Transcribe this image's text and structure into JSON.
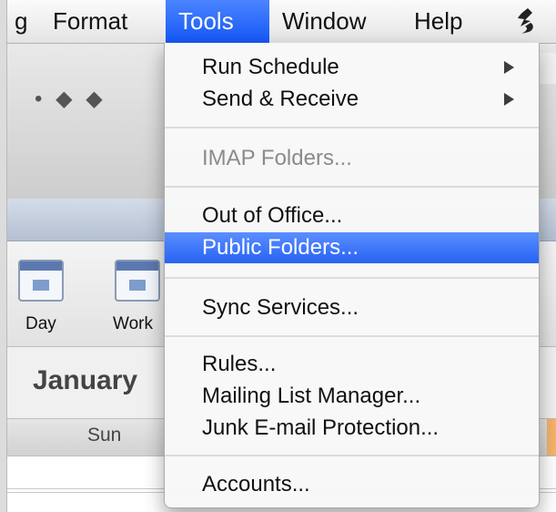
{
  "menubar": {
    "items": [
      {
        "label": "g"
      },
      {
        "label": "Format"
      },
      {
        "label": "Tools",
        "active": true
      },
      {
        "label": "Window"
      },
      {
        "label": "Help"
      }
    ],
    "script_icon": "applescript-icon"
  },
  "background": {
    "ribbon": {
      "day_label": "Day",
      "work_label": "Work"
    },
    "date_title": "January",
    "weekday": "Sun"
  },
  "tools_menu": {
    "items": [
      {
        "label": "Run Schedule",
        "submenu": true
      },
      {
        "label": "Send & Receive",
        "submenu": true
      },
      {
        "label": "IMAP Folders...",
        "disabled": true
      },
      {
        "label": "Out of Office..."
      },
      {
        "label": "Public Folders...",
        "highlighted": true
      },
      {
        "label": "Sync Services..."
      },
      {
        "label": "Rules..."
      },
      {
        "label": "Mailing List Manager..."
      },
      {
        "label": "Junk E-mail Protection..."
      },
      {
        "label": "Accounts..."
      }
    ]
  },
  "colors": {
    "menu_highlight": "#2f6bf5",
    "menubar_active": "#1a5cf7",
    "orange_accent": "#f5b46a"
  }
}
